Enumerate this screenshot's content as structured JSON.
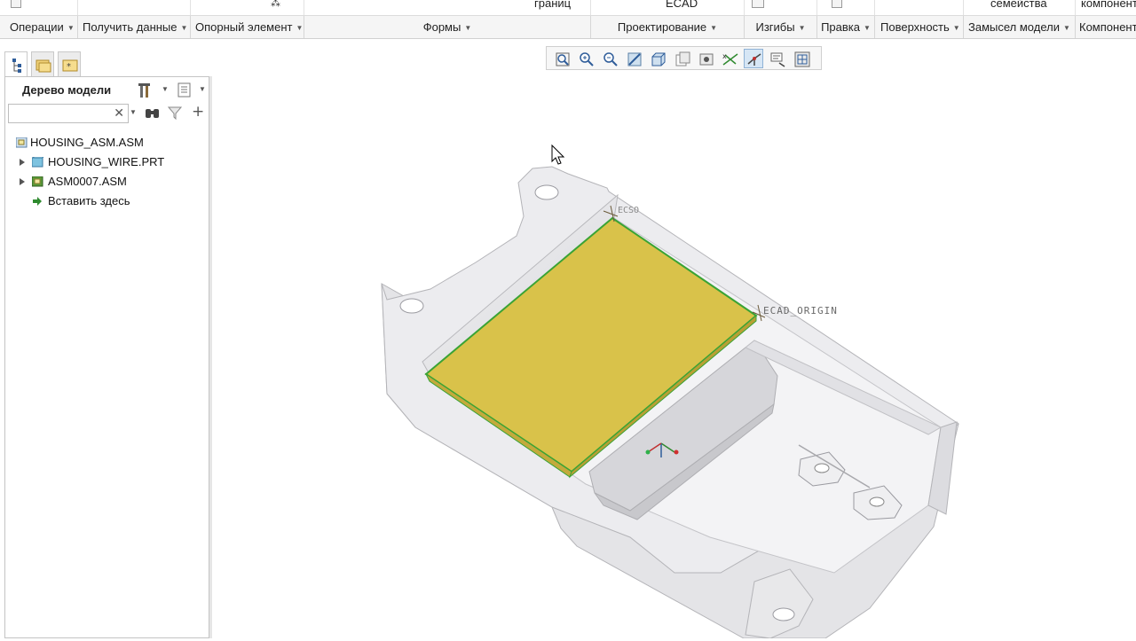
{
  "ribbon_top": {
    "cut_labels": [
      "границ",
      "ECAD",
      "семейства",
      "компонент"
    ]
  },
  "groups": [
    {
      "label": "Операции",
      "has_arrow": true
    },
    {
      "label": "Получить данные",
      "has_arrow": true
    },
    {
      "label": "Опорный элемент",
      "has_arrow": true
    },
    {
      "label": "Формы",
      "has_arrow": true
    },
    {
      "label": "Проектирование",
      "has_arrow": true
    },
    {
      "label": "Изгибы",
      "has_arrow": true
    },
    {
      "label": "Правка",
      "has_arrow": true
    },
    {
      "label": "Поверхность",
      "has_arrow": true
    },
    {
      "label": "Замысел модели",
      "has_arrow": true
    },
    {
      "label": "Компонент",
      "has_arrow": false
    }
  ],
  "navigator": {
    "tabs": [
      "model-tree-tab",
      "folder-browser-tab",
      "favorites-tab"
    ],
    "title": "Дерево модели",
    "search": {
      "value": "",
      "placeholder": ""
    }
  },
  "tree": [
    {
      "label": "HOUSING_ASM.ASM",
      "icon": "assembly-icon",
      "expandable": false
    },
    {
      "label": "HOUSING_WIRE.PRT",
      "icon": "part-icon",
      "expandable": true
    },
    {
      "label": "ASM0007.ASM",
      "icon": "sub-assembly-icon",
      "expandable": true
    },
    {
      "label": "Вставить здесь",
      "icon": "insert-here-icon",
      "expandable": false
    }
  ],
  "view_toolbar": {
    "buttons": [
      "refit-icon",
      "zoom-in-icon",
      "zoom-out-icon",
      "repaint-icon",
      "named-views-icon",
      "display-style-icon",
      "perspective-icon",
      "datum-display-icon",
      "spin-center-icon",
      "annotation-display-icon",
      "saved-orientations-icon"
    ],
    "active": "spin-center-icon"
  },
  "viewport": {
    "annotations": [
      "ECAD_ORIGIN",
      "ECSO"
    ]
  },
  "colors": {
    "board_fill": "#d9c24a",
    "board_edge": "#3aa335",
    "housing": "#e6e6e8",
    "housing_edge": "#b4b4b8"
  }
}
